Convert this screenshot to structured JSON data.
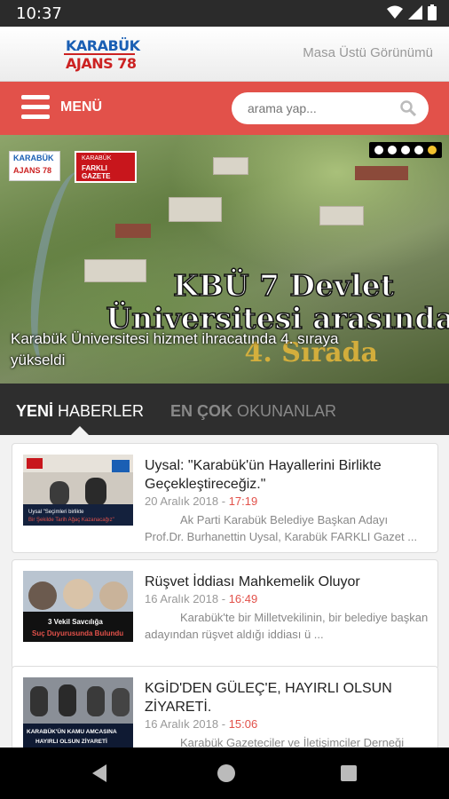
{
  "status_bar": {
    "time": "10:37"
  },
  "header": {
    "logo_line1": "KARABÜK",
    "logo_line2": "AJANS 78",
    "desktop_link": "Masa Üstü Görünümü"
  },
  "menubar": {
    "menu_label": "MENÜ",
    "search_placeholder": "arama yap..."
  },
  "hero": {
    "logo_small_line1": "KARABÜK",
    "logo_small_line2": "AJANS 78",
    "badge_line1": "KARABÜK",
    "badge_line2": "FARKLI GAZETE",
    "image_text_line1": "KBÜ 7 Devlet",
    "image_text_line2": "Üniversitesi arasında",
    "image_text_line3": "4. Sırada",
    "caption": "Karabük Üniversitesi hizmet ihracatında 4. sıraya yükseldi",
    "slide_count": 5,
    "active_slide": 5
  },
  "tabs": [
    {
      "bold": "YENİ",
      "rest": " HABERLER"
    },
    {
      "bold": "EN ÇOK",
      "rest": " OKUNANLAR"
    }
  ],
  "articles": [
    {
      "title": "Uysal: \"Karabük'ün Hayallerini Birlikte Geçekleştireceğiz.\"",
      "date": "20 Aralık 2018",
      "time": "17:19",
      "excerpt": "Ak Parti Karabük Belediye Başkan Adayı Prof.Dr. Burhanettin Uysal, Karabük FARKLI Gazet ..."
    },
    {
      "title": "Rüşvet İddiası Mahkemelik Oluyor",
      "date": "16 Aralık 2018",
      "time": "16:49",
      "excerpt": "Karabük'te bir Milletvekilinin, bir belediye başkan adayından rüşvet aldığı iddiası ü ..."
    },
    {
      "title": "KGİD'DEN GÜLEÇ'E, HAYIRLI OLSUN ZİYARETİ.",
      "date": "16 Aralık 2018",
      "time": "15:06",
      "excerpt": "Karabük Gazeteciler ve İletişimciler Derneği"
    }
  ],
  "thumbnails": [
    {
      "caption_line1": "Uysal \"Seçimleri birlikte",
      "caption_line2": "Bir Şekilde Tarih Ağaç Kazanacağız\""
    },
    {
      "caption_line1": "3 Vekil Savcılığa",
      "caption_line2": "Suç Duyurusunda Bulundu"
    },
    {
      "caption_line1": "KARABÜK'ÜN KAMU AMCASINA",
      "caption_line2": "HAYIRLI OLSUN ZİYARETİ"
    }
  ],
  "colors": {
    "accent": "#e2514a",
    "tab_bg": "#2e2e2e",
    "active_dot": "#f2c12e"
  }
}
